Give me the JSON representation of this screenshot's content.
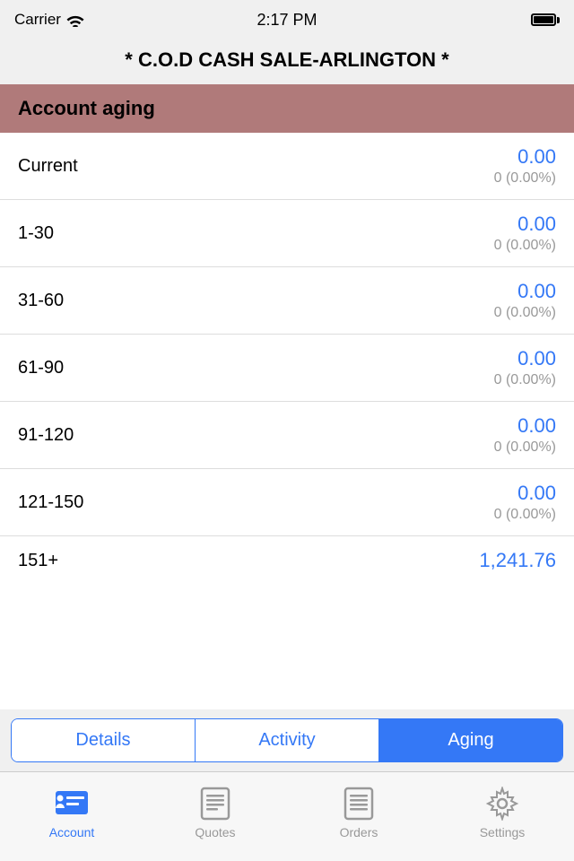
{
  "statusBar": {
    "carrier": "Carrier",
    "time": "2:17 PM"
  },
  "pageTitle": "* C.O.D CASH SALE-ARLINGTON *",
  "sectionHeader": "Account aging",
  "agingRows": [
    {
      "label": "Current",
      "amount": "0.00",
      "percent": "0 (0.00%)"
    },
    {
      "label": "1-30",
      "amount": "0.00",
      "percent": "0 (0.00%)"
    },
    {
      "label": "31-60",
      "amount": "0.00",
      "percent": "0 (0.00%)"
    },
    {
      "label": "61-90",
      "amount": "0.00",
      "percent": "0 (0.00%)"
    },
    {
      "label": "91-120",
      "amount": "0.00",
      "percent": "0 (0.00%)"
    },
    {
      "label": "121-150",
      "amount": "0.00",
      "percent": "0 (0.00%)"
    }
  ],
  "partialRow": {
    "label": "151+",
    "amount": "1,241.76"
  },
  "segments": {
    "items": [
      "Details",
      "Activity",
      "Aging"
    ],
    "activeIndex": 2
  },
  "bottomTabs": [
    {
      "label": "Account",
      "icon": "account-icon",
      "active": true
    },
    {
      "label": "Quotes",
      "icon": "quotes-icon",
      "active": false
    },
    {
      "label": "Orders",
      "icon": "orders-icon",
      "active": false
    },
    {
      "label": "Settings",
      "icon": "settings-icon",
      "active": false
    }
  ]
}
